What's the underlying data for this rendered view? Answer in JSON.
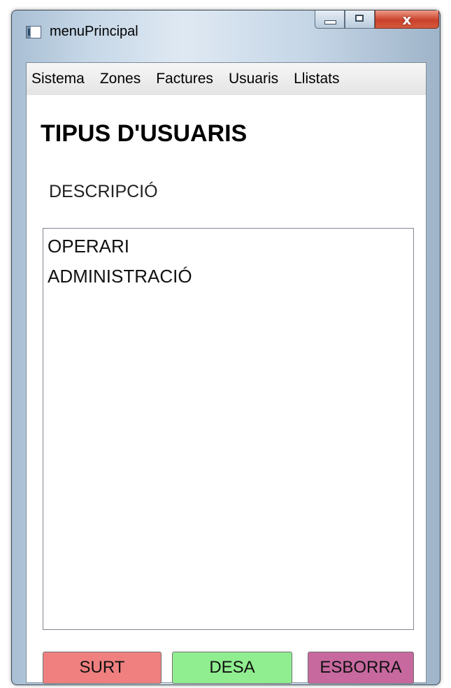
{
  "window": {
    "title": "menuPrincipal"
  },
  "caption": {
    "close_glyph": "x"
  },
  "menu": {
    "items": [
      "Sistema",
      "Zones",
      "Factures",
      "Usuaris",
      "Llistats"
    ]
  },
  "main": {
    "heading": "TIPUS D'USUARIS",
    "column_label": "DESCRIPCIÓ",
    "list": [
      "OPERARI",
      "ADMINISTRACIÓ"
    ]
  },
  "buttons": {
    "surt": "SURT",
    "desa": "DESA",
    "esborra": "ESBORRA"
  },
  "colors": {
    "surt": "#f08080",
    "desa": "#90ee90",
    "esborra": "#c7699f"
  }
}
